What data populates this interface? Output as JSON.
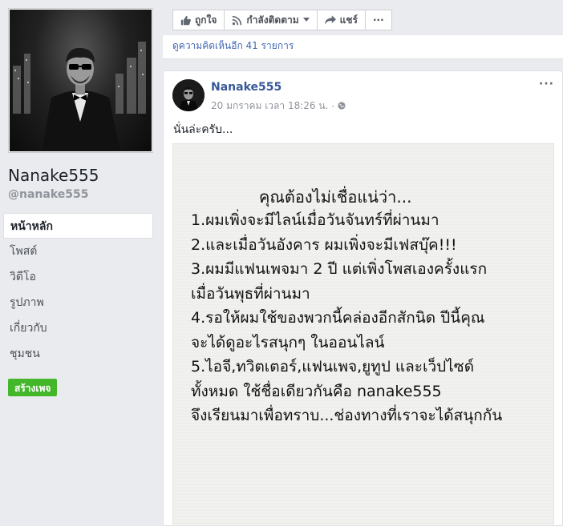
{
  "sidebar": {
    "page_name": "Nanake555",
    "handle": "@nanake555",
    "nav": [
      {
        "label": "หน้าหลัก",
        "active": true
      },
      {
        "label": "โพสต์"
      },
      {
        "label": "วิดีโอ"
      },
      {
        "label": "รูปภาพ"
      },
      {
        "label": "เกี่ยวกับ"
      },
      {
        "label": "ชุมชน"
      }
    ],
    "create_page_label": "สร้างเพจ"
  },
  "action_bar": {
    "like_label": "ถูกใจ",
    "follow_label": "กำลังติดตาม",
    "share_label": "แชร์",
    "more_label": "···"
  },
  "strip": {
    "text": "ดูความคิดเห็นอีก 41 รายการ"
  },
  "post": {
    "author": "Nanake555",
    "timestamp": "20 มกราคม เวลา 18:26 น.",
    "separator": "·",
    "menu": "···",
    "text": "นั่นล่ะครับ...",
    "image": {
      "heading": "คุณต้องไม่เชื่อแน่ว่า...",
      "lines": [
        "1.ผมเพิ่งจะมีไลน์เมื่อวันจันทร์ที่ผ่านมา",
        "2.และเมื่อวันอังคาร ผมเพิ่งจะมีเฟสบุ๊ค!!!",
        "3.ผมมีแฟนเพจมา 2 ปี แต่เพิ่งโพสเองครั้งแรก",
        "เมื่อวันพุธที่ผ่านมา",
        "4.รอให้ผมใช้ของพวกนี้คล่องอีกสักนิด ปีนี้คุณ",
        "จะได้ดูอะไรสนุกๆ ในออนไลน์",
        "5.ไอจี,ทวิตเตอร์,แฟนเพจ,ยูทูป และเว็ปไซด์",
        "ทั้งหมด ใช้ชื่อเดียวกันคือ nanake555",
        "จึงเรียนมาเพื่อทราบ...ช่องทางที่เราจะได้สนุกกัน"
      ]
    }
  },
  "colors": {
    "background": "#e9ebee",
    "link": "#365899",
    "create_button": "#42b72a",
    "muted": "#90949c"
  }
}
